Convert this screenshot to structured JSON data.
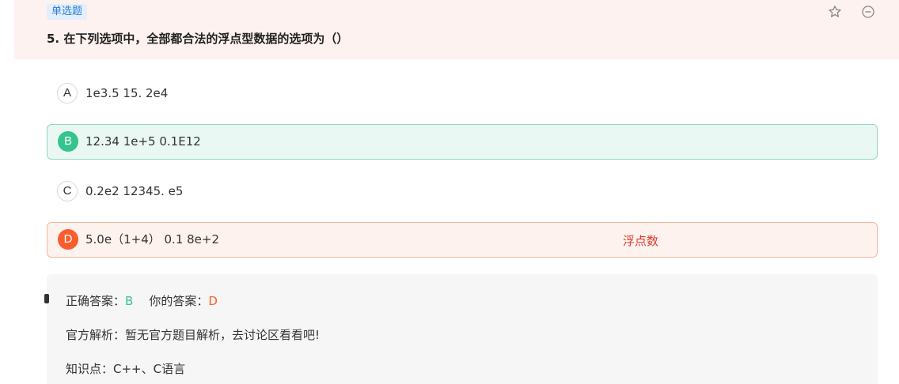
{
  "question": {
    "type_tag": "单选题",
    "title": "5. 在下列选项中，全部都合法的浮点型数据的选项为（）",
    "icons": [
      "star-icon",
      "minus-circle-icon"
    ]
  },
  "options": [
    {
      "letter": "A",
      "text": "1e3.5 15. 2e4",
      "state": "normal"
    },
    {
      "letter": "B",
      "text": "12.34 1e+5 0.1E12",
      "state": "correct"
    },
    {
      "letter": "C",
      "text": "0.2e2 12345. e5",
      "state": "normal"
    },
    {
      "letter": "D",
      "text": "5.0e（1+4） 0.1 8e+2",
      "state": "wrong",
      "note": "浮点数"
    }
  ],
  "answer": {
    "correct_label": "正确答案：",
    "correct_value": "B",
    "yours_label": "你的答案：",
    "yours_value": "D",
    "analysis": "官方解析：暂无官方题目解析，去讨论区看看吧!",
    "knowledge": "知识点：C++、C语言"
  },
  "colors": {
    "header_bg": "#fdf2ef",
    "tag_text": "#2a7ed8",
    "correct": "#36c48e",
    "wrong": "#f95d2e",
    "note": "#e0392b"
  }
}
